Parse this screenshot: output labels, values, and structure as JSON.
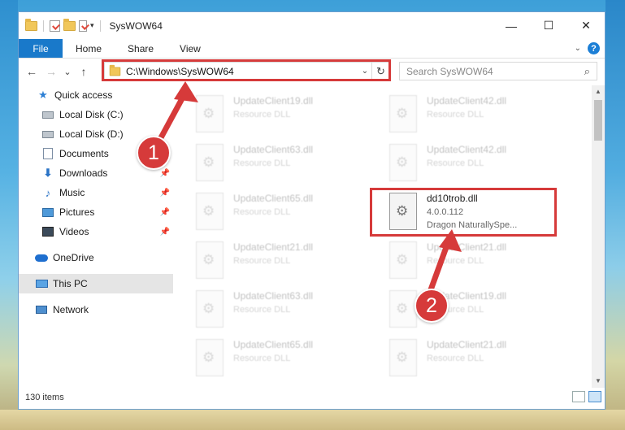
{
  "window": {
    "title": "SysWOW64",
    "controls": {
      "minimize": "—",
      "maximize": "☐",
      "close": "✕"
    }
  },
  "ribbon": {
    "tabs": [
      "File",
      "Home",
      "Share",
      "View"
    ],
    "help": "?"
  },
  "nav": {
    "back": "←",
    "forward": "→",
    "recent": "⌄",
    "up": "↑",
    "address": "C:\\Windows\\SysWOW64",
    "search_placeholder": "Search SysWOW64"
  },
  "sidebar": {
    "items": [
      {
        "label": "Quick access",
        "icon": "star-icon"
      },
      {
        "label": "Local Disk (C:)",
        "icon": "drive-icon"
      },
      {
        "label": "Local Disk (D:)",
        "icon": "drive-icon"
      },
      {
        "label": "Documents",
        "icon": "documents-icon"
      },
      {
        "label": "Downloads",
        "icon": "downloads-icon",
        "pinned": true
      },
      {
        "label": "Music",
        "icon": "music-icon",
        "pinned": true
      },
      {
        "label": "Pictures",
        "icon": "pictures-icon",
        "pinned": true
      },
      {
        "label": "Videos",
        "icon": "videos-icon",
        "pinned": true
      },
      {
        "label": "OneDrive",
        "icon": "onedrive-icon"
      },
      {
        "label": "This PC",
        "icon": "pc-icon",
        "selected": true
      },
      {
        "label": "Network",
        "icon": "network-icon"
      }
    ]
  },
  "files": [
    {
      "name": "UpdateClient19.dll",
      "type": "Resource DLL"
    },
    {
      "name": "UpdateClient42.dll",
      "type": "Resource DLL"
    },
    {
      "name": "UpdateClient63.dll",
      "type": "Resource DLL"
    },
    {
      "name": "UpdateClient42.dll",
      "type": "Resource DLL"
    },
    {
      "name": "UpdateClient65.dll",
      "type": "Resource DLL"
    },
    {
      "name": "dd10trob.dll",
      "version": "4.0.0.112",
      "type": "Dragon NaturallySpe...",
      "focused": true
    },
    {
      "name": "UpdateClient21.dll",
      "type": "Resource DLL"
    },
    {
      "name": "UpdateClient21.dll",
      "type": "Resource DLL"
    },
    {
      "name": "UpdateClient63.dll",
      "type": "Resource DLL"
    },
    {
      "name": "UpdateClient19.dll",
      "type": "Resource DLL"
    },
    {
      "name": "UpdateClient65.dll",
      "type": "Resource DLL"
    },
    {
      "name": "UpdateClient21.dll",
      "type": "Resource DLL"
    }
  ],
  "status": {
    "item_count": "130 items"
  },
  "callouts": {
    "one": "1",
    "two": "2"
  },
  "colors": {
    "accent": "#1979ca",
    "highlight": "#d63a3a"
  }
}
